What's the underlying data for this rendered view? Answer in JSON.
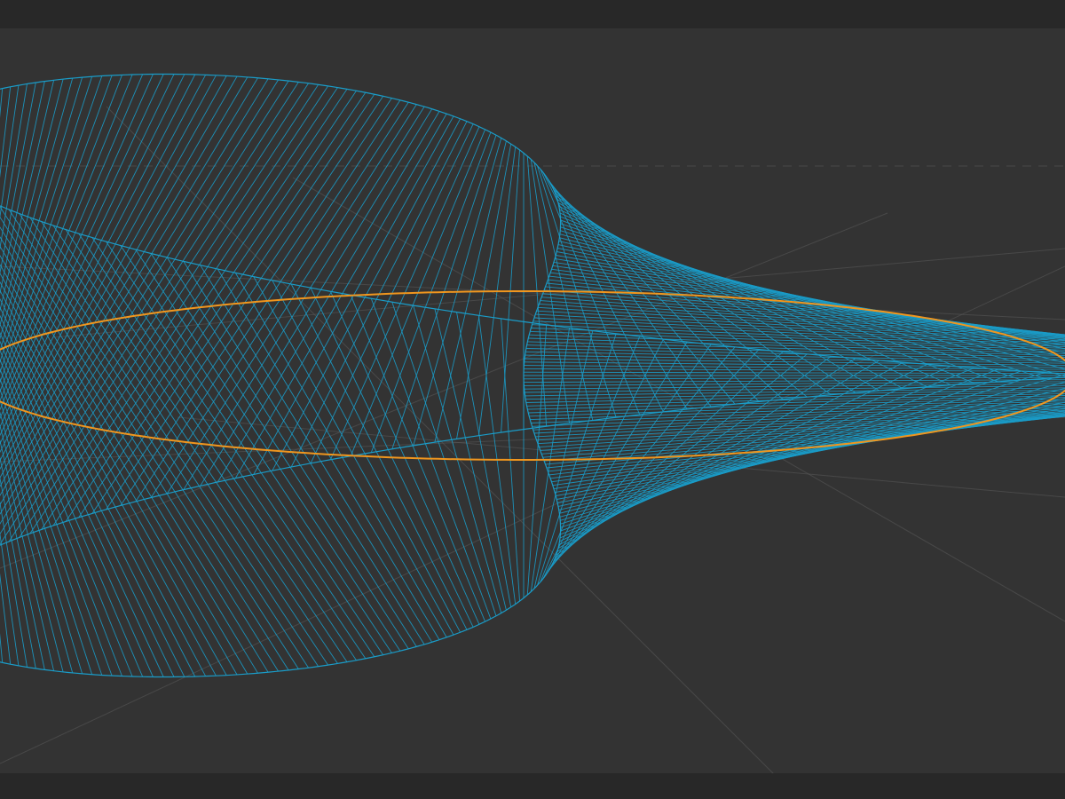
{
  "viewport": {
    "background_color": "#333333",
    "chrome_color": "#282828"
  },
  "scene": {
    "object": "mobius-strip",
    "display_mode": "wireframe",
    "wire_color": "#1a9cc8",
    "centerline_color": "#f0961e",
    "grid_color": "#5a5a5a",
    "horizon_line": "dashed"
  }
}
